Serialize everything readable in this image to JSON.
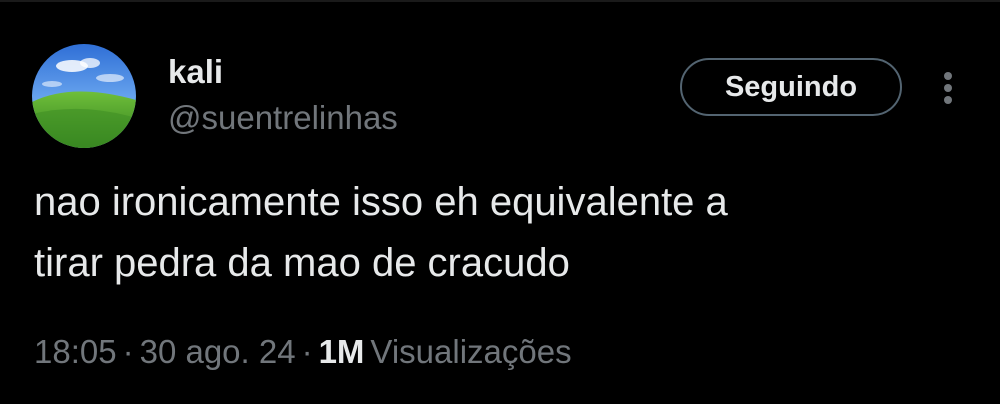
{
  "author": {
    "display_name": "kali",
    "handle": "@suentrelinhas",
    "avatar_icon": "green-hill-landscape-avatar"
  },
  "actions": {
    "follow_label": "Seguindo",
    "more_icon": "vertical-ellipsis-icon"
  },
  "tweet": {
    "lines": [
      "nao ironicamente isso eh equivalente a",
      "tirar pedra da mao de cracudo"
    ]
  },
  "meta": {
    "time": "18:05",
    "separator": "·",
    "date": "30 ago. 24",
    "views_count": "1M",
    "views_label": "Visualizações"
  },
  "colors": {
    "background": "#000000",
    "text_primary": "#e7e9ea",
    "text_secondary": "#71767b",
    "button_border": "#536471"
  }
}
